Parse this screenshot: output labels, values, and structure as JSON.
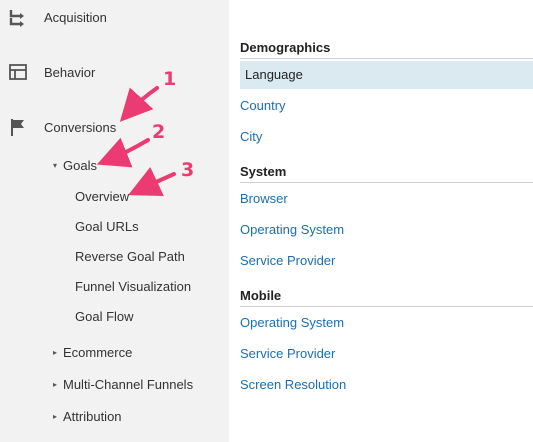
{
  "sidebar": {
    "top_items": [
      {
        "label": "Acquisition",
        "icon": "acquisition-arrows-icon"
      },
      {
        "label": "Behavior",
        "icon": "behavior-layout-icon"
      },
      {
        "label": "Conversions",
        "icon": "flag-icon"
      }
    ],
    "goals": {
      "label": "Goals",
      "caret": "▾",
      "children": [
        "Overview",
        "Goal URLs",
        "Reverse Goal Path",
        "Funnel Visualization",
        "Goal Flow"
      ]
    },
    "collapsed_sections": [
      {
        "label": "Ecommerce",
        "caret": "▸"
      },
      {
        "label": "Multi-Channel Funnels",
        "caret": "▸"
      },
      {
        "label": "Attribution",
        "caret": "▸"
      }
    ]
  },
  "main": {
    "sections": [
      {
        "title": "Demographics",
        "items": [
          "Language",
          "Country",
          "City"
        ],
        "selected": "Language"
      },
      {
        "title": "System",
        "items": [
          "Browser",
          "Operating System",
          "Service Provider"
        ]
      },
      {
        "title": "Mobile",
        "items": [
          "Operating System",
          "Service Provider",
          "Screen Resolution"
        ]
      }
    ]
  },
  "annotations": {
    "numbers": [
      "1",
      "2",
      "3"
    ],
    "color": "#ec3a73"
  },
  "colors": {
    "link": "#1a6fb3",
    "selected_background": "#dbe9f1",
    "sidebar_background": "#f2f2f2"
  }
}
